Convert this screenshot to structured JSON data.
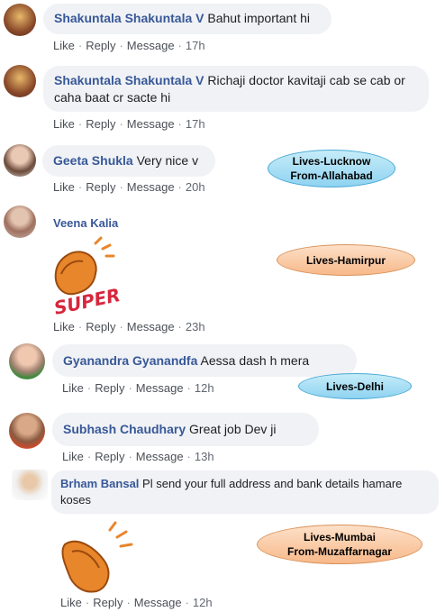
{
  "comments": [
    {
      "name": "Shakuntala Shakuntala V",
      "text": "Bahut important hi",
      "time": "17h"
    },
    {
      "name": "Shakuntala Shakuntala V",
      "text": "Richaji doctor kavitaji cab se cab or caha baat cr sacte hi",
      "time": "17h"
    },
    {
      "name": "Geeta Shukla",
      "text": "Very nice v",
      "time": "20h"
    },
    {
      "name": "Veena Kalia",
      "text": "",
      "time": "23h"
    },
    {
      "name": "Gyanandra Gyanandfa",
      "text": "Aessa dash h mera",
      "time": "12h"
    },
    {
      "name": "Subhash Chaudhary",
      "text": "Great job Dev ji",
      "time": "13h"
    },
    {
      "name": "Brham Bansal",
      "text": "Pl send your full address and bank details hamare koses",
      "time": "12h"
    }
  ],
  "actions": {
    "like": "Like",
    "reply": "Reply",
    "message": "Message",
    "sep": "·"
  },
  "sticker_text": "SUPER!",
  "tags": [
    {
      "line1": "Lives-Lucknow",
      "line2": "From-Allahabad"
    },
    {
      "line1": "Lives-Hamirpur",
      "line2": ""
    },
    {
      "line1": "Lives-Delhi",
      "line2": ""
    },
    {
      "line1": "Lives-Mumbai",
      "line2": "From-Muzaffarnagar"
    }
  ],
  "colors": {
    "name": "#385898",
    "bubble": "#f0f2f5",
    "tag_blue": "#8fd3f1",
    "tag_orange": "#f7b98a"
  }
}
